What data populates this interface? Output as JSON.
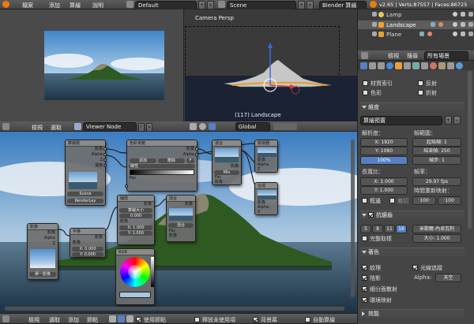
{
  "topbar": {
    "menus": [
      "檔案",
      "添加",
      "算繪",
      "說明"
    ],
    "layout": "Default",
    "scene": "Scene",
    "engine": "Blender 算繪",
    "stats": "v2.65 | Verts:87557 | Faces:86725"
  },
  "viewport": {
    "label": "Camera Persp",
    "object": "(117) Landscape"
  },
  "outliner": {
    "items": [
      {
        "label": "Lamp"
      },
      {
        "label": "Landscape"
      },
      {
        "label": "Plane"
      }
    ],
    "menu_view": "檢視",
    "menu_search": "搜尋",
    "filter": "所有場景"
  },
  "properties": {
    "tex_left": [
      "材質索引",
      "色彩"
    ],
    "tex_right": [
      "反射",
      "折射"
    ],
    "dims_header": "維度",
    "preset": "算繪預置",
    "resolution_label": "解析度：",
    "res_x": "X: 1920",
    "res_y": "Y: 1080",
    "res_pct": "100%",
    "frame_range_label": "幀範圍：",
    "start_frame": "起始幀: 1",
    "end_frame": "結束幀: 250",
    "frame_step": "幀步: 1",
    "aspect_label": "長寬比：",
    "aspect_x": "X: 1.000",
    "aspect_y": "Y: 1.000",
    "frame_rate_label": "幀率：",
    "fps": "29.97 fps",
    "time_remap_label": "時間重新映射：",
    "remap_old": "·100·",
    "remap_new": "·100·",
    "border": "框邊",
    "crop": "裁切",
    "aa_header": "抗鋸齒",
    "aa_samples": [
      "5",
      "8",
      "11",
      "16"
    ],
    "aa_filter": "米歇爾-內卓瓦利",
    "full_sample": "完整取樣",
    "size": "大小: 1.000",
    "shading_header": "著色",
    "textures": "紋理",
    "raytracing": "光線追蹤",
    "shadows": "陰影",
    "alpha_label": "Alpha:",
    "alpha_value": "天空",
    "sss": "細分面散射",
    "env_map": "環境映射",
    "performance_header": "效能"
  },
  "node_editor": {
    "menus": [
      "檢視",
      "選取",
      "添加",
      "節點"
    ],
    "node_tree": "Viewer Node",
    "orientation": "Global",
    "use_nodes": "使用節點",
    "free_unused": "釋放未使用項",
    "backdrop": "背景幕",
    "auto_render": "自動算繪"
  },
  "nodes": {
    "render_layers": {
      "title": "算繪層",
      "out1": "影像",
      "out2": "Alpha",
      "out3": "Z",
      "out4": "速度",
      "scene": "Scene",
      "layer": "RenderLay"
    },
    "color_ramp": {
      "title": "色彩漸變",
      "out1": "影像",
      "out2": "Alpha",
      "btn_add": "添加",
      "btn_del": "刪除",
      "btn_flip": "F",
      "interp": "線性",
      "in1": "Fac"
    },
    "mix": {
      "title": "混合",
      "out1": "影像",
      "mode": "Mix",
      "in_fac": "Fac",
      "in1": "影像",
      "in2": "影像"
    },
    "viewer": {
      "title": "檢視器",
      "in1": "影像",
      "in2": "Alpha",
      "in3": "Z"
    },
    "composite": {
      "title": "合成",
      "in1": "影像",
      "in2": "Alpha",
      "in3": "Z"
    },
    "scale": {
      "title": "縮放",
      "out1": "影像",
      "mode": "算繪大小",
      "in1": "影像",
      "x": "X: 1.000",
      "y": "Y: 1.000",
      "val": "0.000"
    },
    "translate": {
      "title": "平移",
      "out1": "影像",
      "in1": "影像",
      "x": "X: 0.000",
      "y": "Y: 0.000"
    },
    "image": {
      "title": "影像",
      "out1": "影像",
      "out2": "Alpha",
      "out3": "Z",
      "btn": "單一影像"
    },
    "rgb": {
      "title": "RGB"
    },
    "mix2": {
      "title": "混合",
      "out1": "影像",
      "mode": "混合",
      "in_fac": "Fac",
      "in1": "影像",
      "in2": "影像"
    }
  }
}
